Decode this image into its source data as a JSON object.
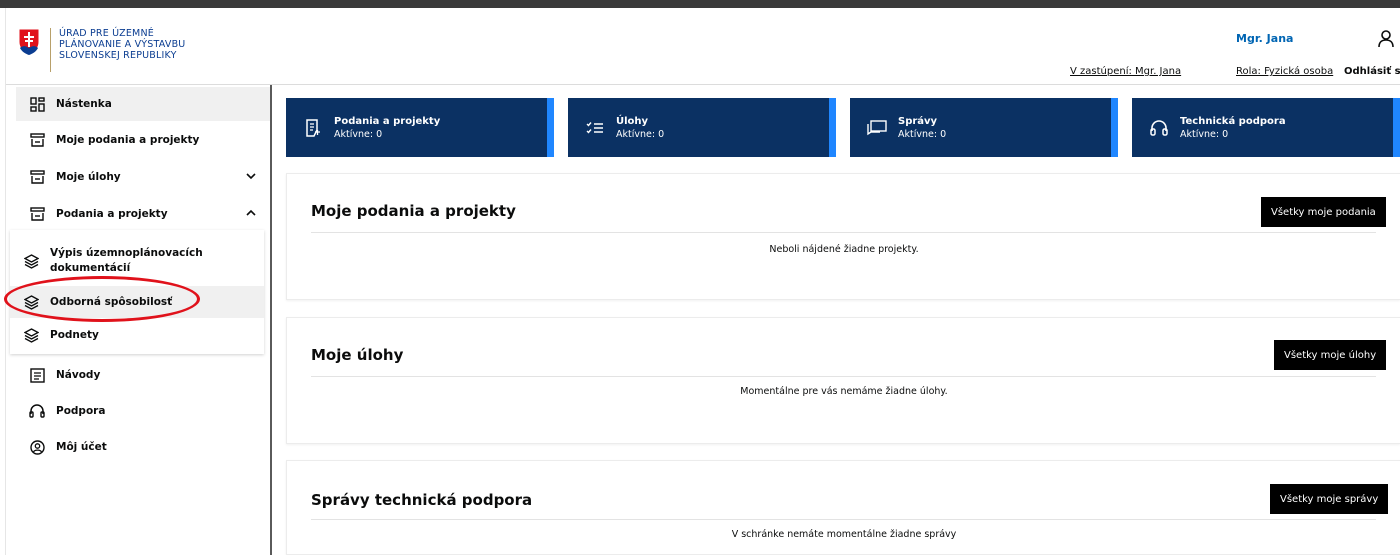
{
  "header": {
    "logo_lines": [
      "ÚRAD PRE ÚZEMNÉ",
      "PLÁNOVANIE A VÝSTAVBU",
      "SLOVENSKEJ REPUBLIKY"
    ],
    "user_name": "Mgr. Jana",
    "representation_link": "V zastúpení: Mgr. Jana",
    "role_link": "Rola: Fyzická osoba",
    "logout_label": "Odhlásiť s"
  },
  "sidebar": {
    "items": [
      {
        "label": "Nástenka",
        "icon": "dashboard-icon"
      },
      {
        "label": "Moje podania a projekty",
        "icon": "inbox-icon"
      },
      {
        "label": "Moje úlohy",
        "icon": "inbox-icon"
      },
      {
        "label": "Podania a projekty",
        "icon": "inbox-icon"
      },
      {
        "label": "Návody",
        "icon": "document-list-icon"
      },
      {
        "label": "Podpora",
        "icon": "headset-icon"
      },
      {
        "label": "Môj účet",
        "icon": "user-circle-icon"
      }
    ],
    "subitems": [
      {
        "label_line1": "Výpis územnoplánovacích",
        "label_line2": "dokumentácií",
        "icon": "layers-icon"
      },
      {
        "label": "Odborná spôsobilosť",
        "icon": "layers-icon"
      },
      {
        "label": "Podnety",
        "icon": "layers-icon"
      }
    ]
  },
  "tiles": [
    {
      "title": "Podania a projekty",
      "subtitle": "Aktívne: 0",
      "icon": "document-icon"
    },
    {
      "title": "Úlohy",
      "subtitle": "Aktívne: 0",
      "icon": "checklist-icon"
    },
    {
      "title": "Správy",
      "subtitle": "Aktívne: 0",
      "icon": "message-icon"
    },
    {
      "title": "Technická podpora",
      "subtitle": "Aktívne: 0",
      "icon": "headset-icon"
    }
  ],
  "cards": [
    {
      "title": "Moje podania a projekty",
      "button": "Všetky moje podania",
      "empty": "Neboli nájdené žiadne projekty."
    },
    {
      "title": "Moje úlohy",
      "button": "Všetky moje úlohy",
      "empty": "Momentálne pre vás nemáme žiadne úlohy."
    },
    {
      "title": "Správy technická podpora",
      "button": "Všetky moje správy",
      "empty": "V schránke nemáte momentálne žiadne správy"
    }
  ],
  "colors": {
    "tile_bg": "#0b3163",
    "tile_stripe": "#1f86ff",
    "link_blue": "#0065b3",
    "annotation_red": "#e0121b"
  }
}
